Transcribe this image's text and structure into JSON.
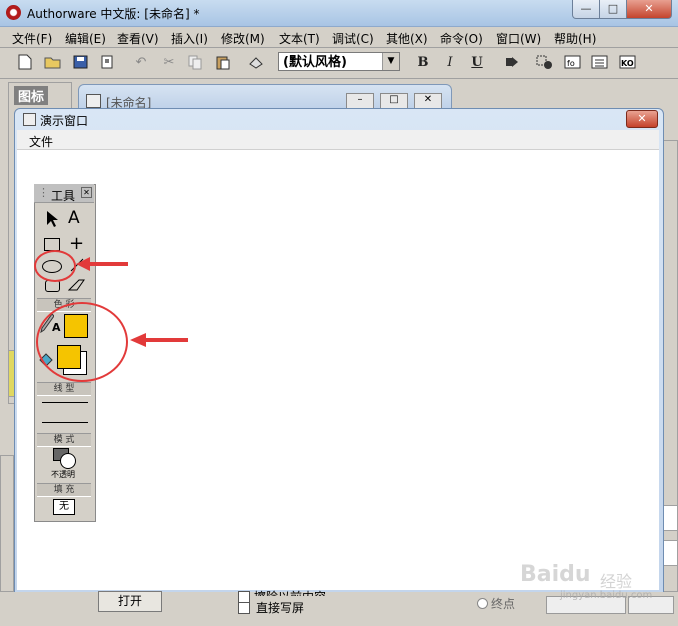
{
  "app": {
    "title": "Authorware 中文版: [未命名] *",
    "caption_min": "—",
    "caption_max": "□",
    "caption_close": "✕"
  },
  "menubar": {
    "items": [
      "文件(F)",
      "编辑(E)",
      "查看(V)",
      "插入(I)",
      "修改(M)",
      "文本(T)",
      "调试(C)",
      "其他(X)",
      "命令(O)",
      "窗口(W)",
      "帮助(H)"
    ]
  },
  "toolbar": {
    "style_select_value": "(默认风格)",
    "bold_label": "B",
    "italic_label": "I",
    "underline_label": "U"
  },
  "icons_panel": {
    "title": "图标"
  },
  "flow_window": {
    "title": "[未命名]"
  },
  "presentation_window": {
    "title": "演示窗口",
    "menu_file": "文件",
    "close_label": "✕"
  },
  "tools_palette": {
    "title": "工具",
    "text_tool_label": "A",
    "color_section": "色 彩",
    "line_section": "线 型",
    "mode_section": "模 式",
    "mode_value": "不透明",
    "fill_section": "填 充",
    "fill_value": "无",
    "color_fill": "#f5c400",
    "annotation_color": "#e23a3a"
  },
  "bottom": {
    "open_button": "打开",
    "check_1_label": "擦除以前内容",
    "check_2_label": "直接写屏",
    "radio_label": "终点"
  },
  "watermark": {
    "main": "Baidu",
    "secondary": "经验",
    "url": "jingyan.baidu.com"
  }
}
